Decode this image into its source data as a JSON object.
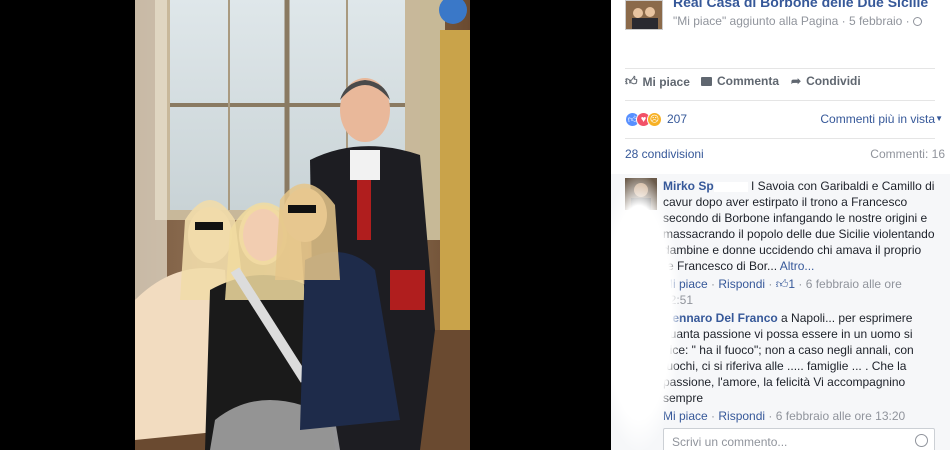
{
  "post": {
    "page_name": "Real Casa di Borbone delle Due Sicilie",
    "subline": "\"Mi piace\" aggiunto alla Pagina · 5 febbraio · ",
    "actions": {
      "like": "Mi piace",
      "comment": "Commenta",
      "share": "Condividi"
    },
    "reactions_count": "207",
    "sort_label": "Commenti più in vista",
    "shares": "28 condivisioni",
    "comments_count": "Commenti: 16"
  },
  "comments": [
    {
      "author": "Mirko Sp",
      "author_rest": "...",
      "text": "I Savoia con Garibaldi e Camillo di cavur dopo aver estirpato il trono a Francesco secondo di Borbone infangando le nostre origini e massacrando il popolo delle due Sicilie violentando dambine e donne uccidendo chi amava il proprio re Francesco di Bor...",
      "more": "Altro...",
      "like": "Mi piace",
      "reply": "Rispondi",
      "likes": "1",
      "time": "6 febbraio alle ore 12:51"
    },
    {
      "author": "Gennaro Del Franco",
      "text": "a Napoli... per esprimere quanta passione vi possa essere in un uomo si dice: \" ha il fuoco\"; non a caso negli annali, con fuochi, ci si riferiva alle ..... famiglie ... . Che la passione, l'amore, la felicità Vi accompagnino sempre",
      "like": "Mi piace",
      "reply": "Rispondi",
      "time": "6 febbraio alle ore 13:20"
    }
  ],
  "reply_placeholder": "Scrivi un commento...",
  "colors": {
    "link": "#365899",
    "muted": "#90949c",
    "like_blue": "#5890ff",
    "love_red": "#f25268",
    "angry": "#f7b125"
  }
}
